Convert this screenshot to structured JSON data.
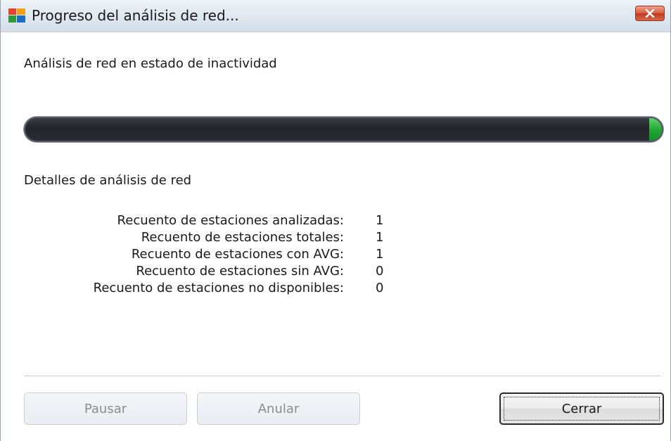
{
  "window": {
    "title": "Progreso del análisis de red...",
    "app_icon": "avg-logo-icon",
    "close_icon": "close-icon"
  },
  "status": {
    "text": "Análisis de red en estado de inactividad"
  },
  "progress": {
    "fraction": 0.02,
    "track_color": "#22262c",
    "fill_color": "#20a632"
  },
  "details": {
    "section_label": "Detalles de análisis de red",
    "rows": [
      {
        "label": "Recuento de estaciones analizadas:",
        "value": "1"
      },
      {
        "label": "Recuento de estaciones totales:",
        "value": "1"
      },
      {
        "label": "Recuento de estaciones con AVG:",
        "value": "1"
      },
      {
        "label": "Recuento de estaciones sin AVG:",
        "value": "0"
      },
      {
        "label": "Recuento de estaciones no disponibles:",
        "value": "0"
      }
    ]
  },
  "buttons": {
    "pause_label": "Pausar",
    "cancel_label": "Anular",
    "close_label": "Cerrar"
  }
}
